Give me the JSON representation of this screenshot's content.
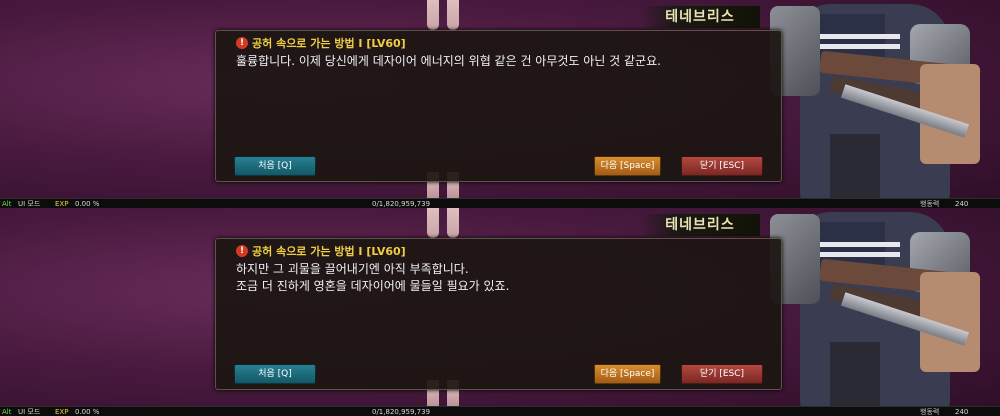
{
  "npc_name": "테네브리스",
  "quest_title": "공허 속으로 가는 방법 I [LV60]",
  "buttons": {
    "first": "처음 [Q]",
    "next": "다음 [Space]",
    "close": "닫기 [ESC]"
  },
  "panels": [
    {
      "lines": [
        "훌륭합니다. 이제 당신에게 데자이어 에너지의 위협 같은 건 아무것도 아닌 것 같군요."
      ]
    },
    {
      "lines": [
        "하지만 그 괴물을 끌어내기엔 아직 부족합니다.",
        "조금 더 진하게 영혼을 데자이어에 물들일 필요가 있죠."
      ]
    }
  ],
  "statusbar": {
    "alt": "Alt",
    "ui_mode": "UI 모드",
    "exp_label": "EXP",
    "exp_percent": "0.00 %",
    "gold": "0/1,820,959,739",
    "fatigue_label": "행동력",
    "fatigue_value": "240"
  }
}
